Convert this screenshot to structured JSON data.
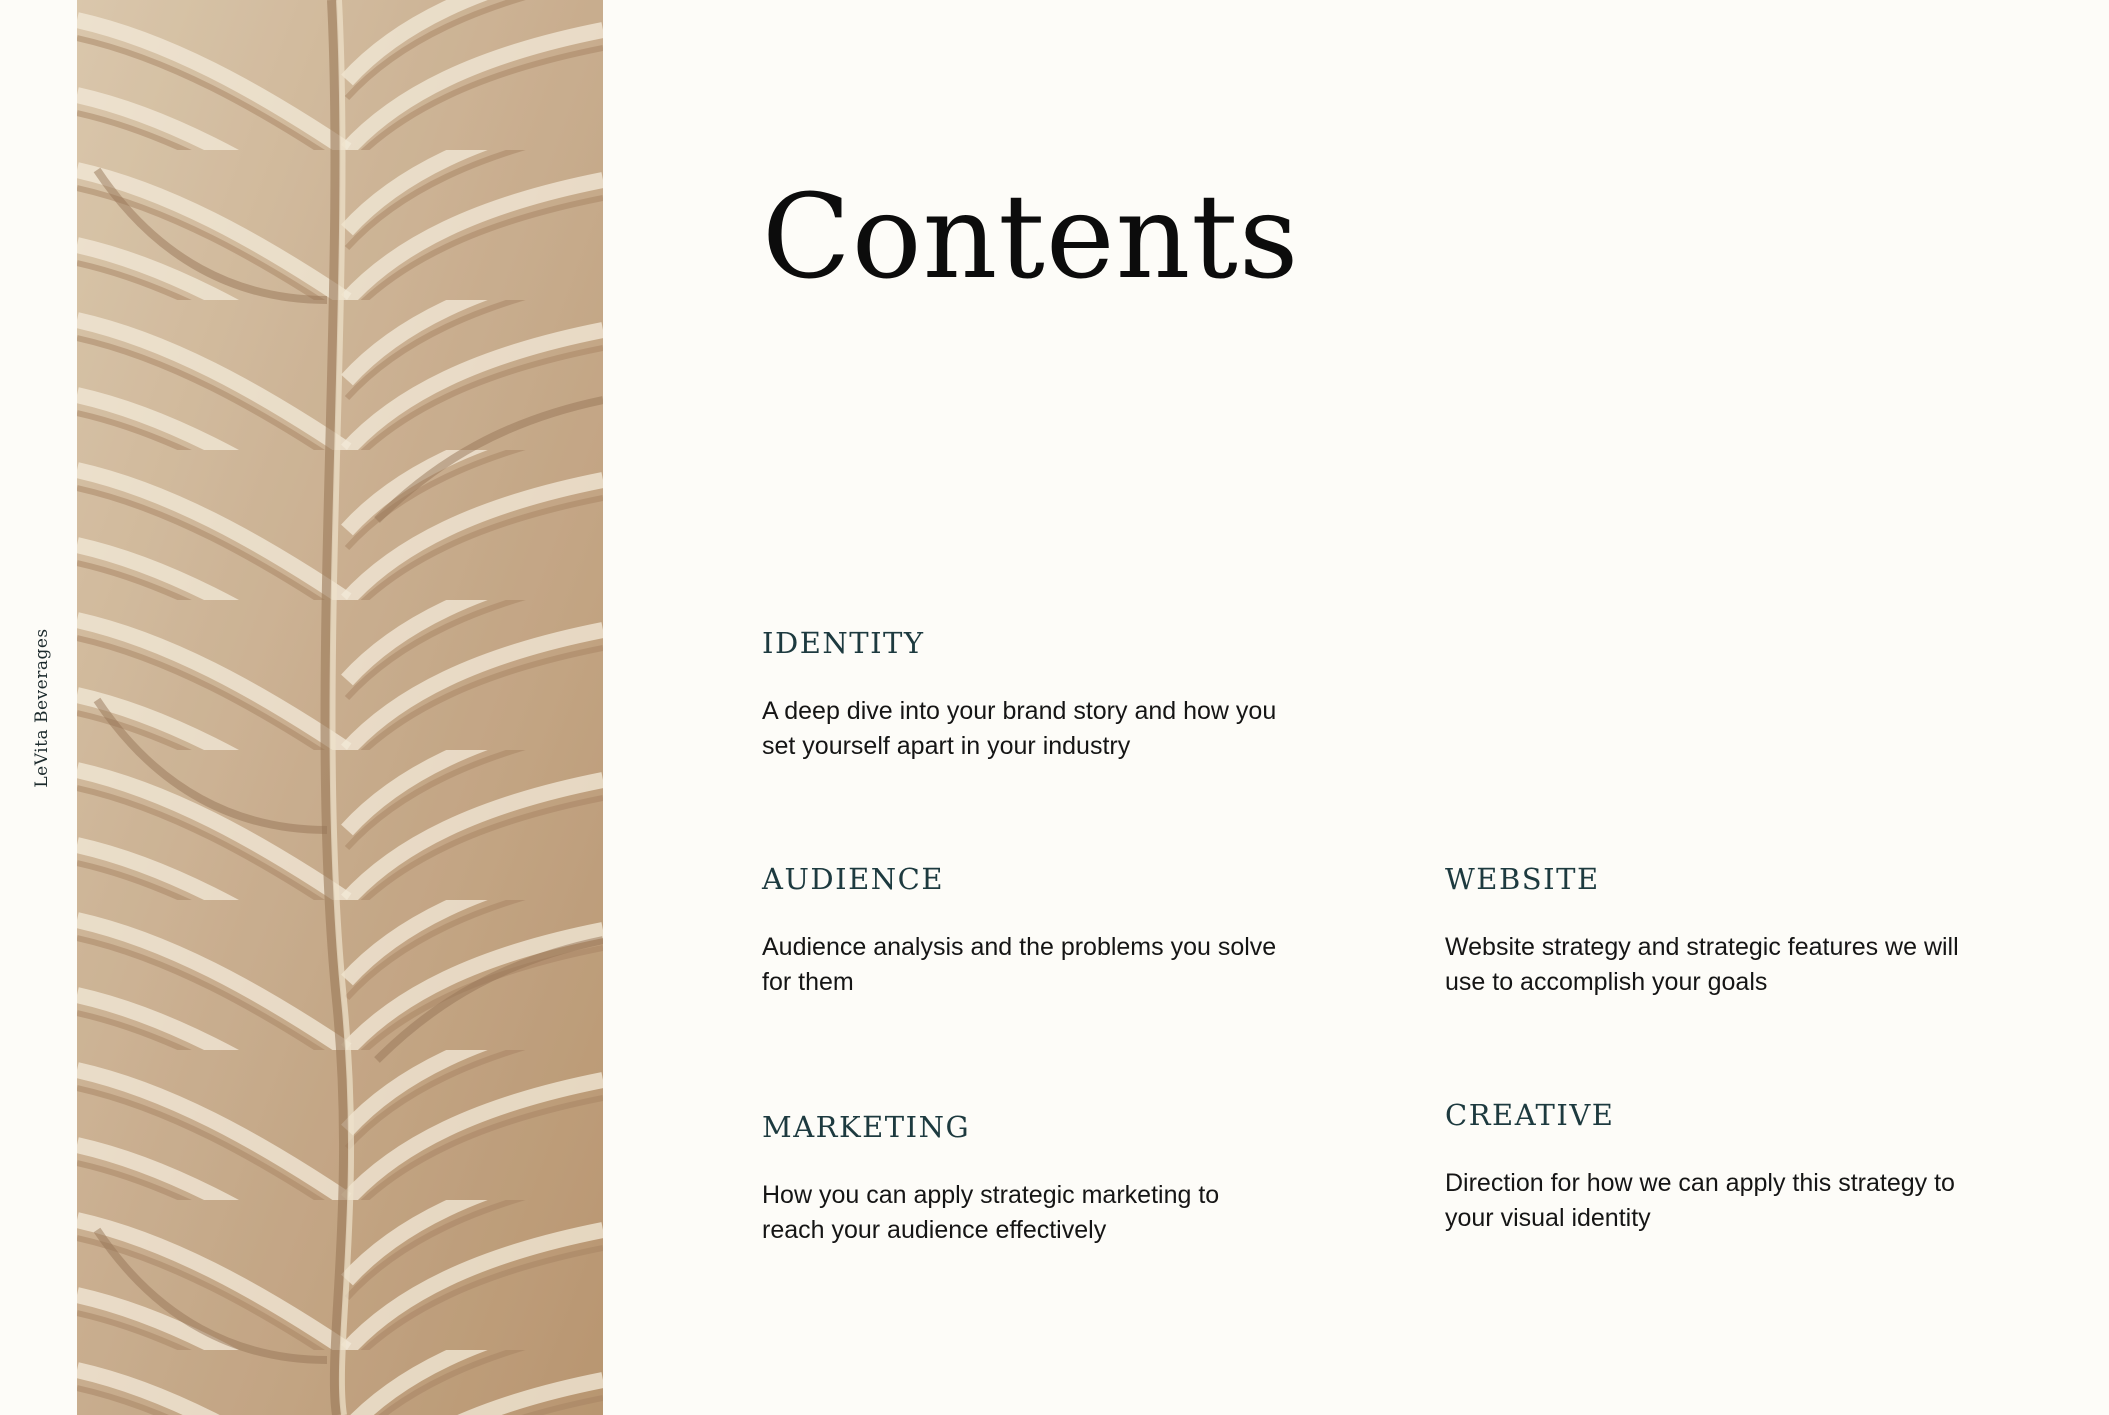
{
  "brand_label": "LeVita Beverages",
  "title": "Contents",
  "accent_color": "#1d3a3f",
  "photo": {
    "subject": "sculpted sand-colored leaf relief texture"
  },
  "sections": {
    "identity": {
      "heading": "IDENTITY",
      "body_line1": "A deep dive into your brand story and how you",
      "body_line2": "set yourself apart in your industry"
    },
    "audience": {
      "heading": "AUDIENCE",
      "body_line1": "Audience analysis and the problems you solve",
      "body_line2": "for them"
    },
    "marketing": {
      "heading": "MARKETING",
      "body_line1": "How you can apply strategic marketing to",
      "body_line2": "reach your audience effectively"
    },
    "website": {
      "heading": "WEBSITE",
      "body_line1": "Website strategy and strategic features we will",
      "body_line2": "use to accomplish your goals"
    },
    "creative": {
      "heading": "CREATIVE",
      "body_line1": "Direction for how we can apply this strategy to",
      "body_line2": "your visual identity"
    }
  }
}
